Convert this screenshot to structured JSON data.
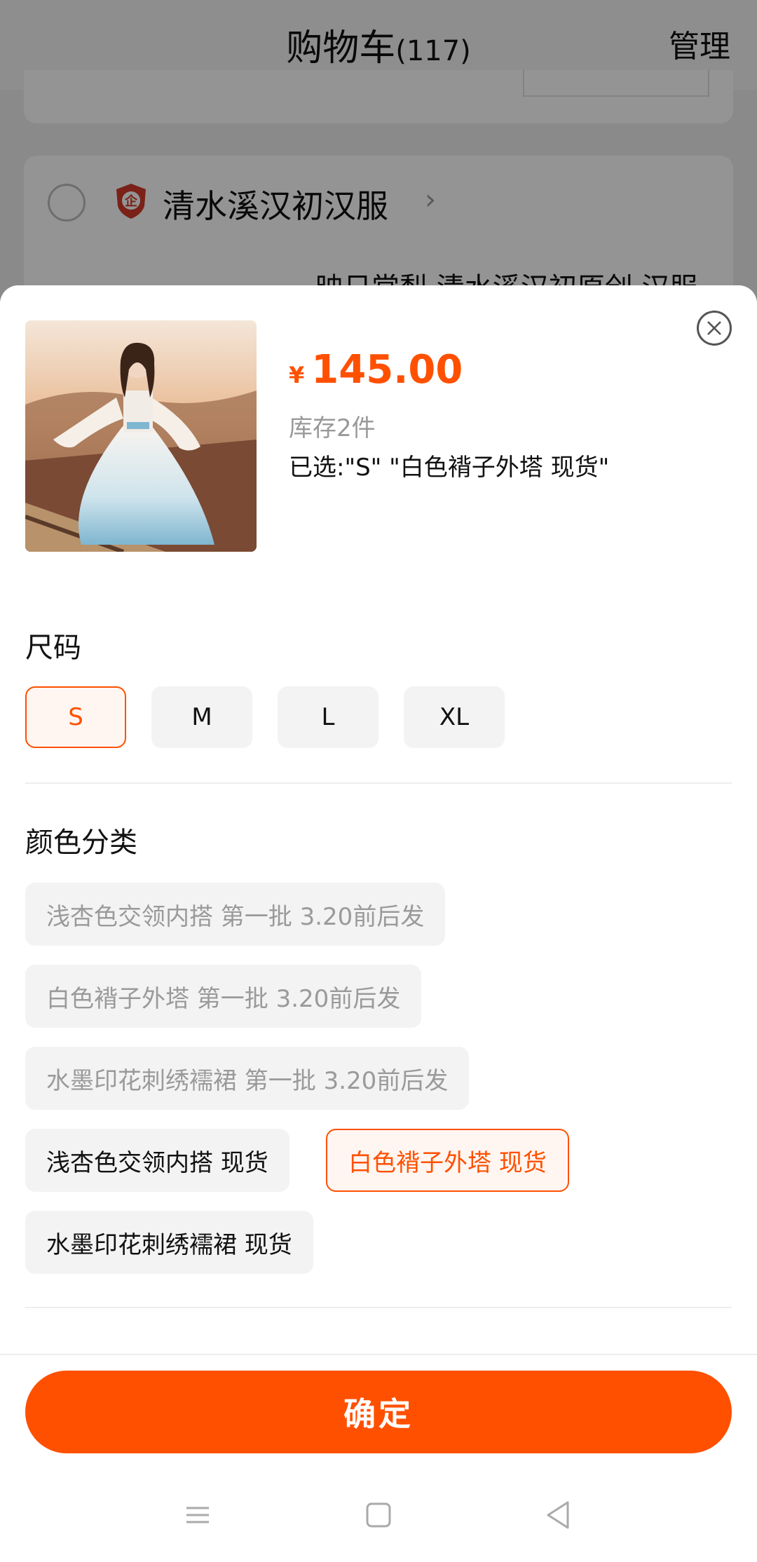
{
  "background": {
    "title": "购物车",
    "count": "(117)",
    "manage_label": "管理",
    "shop_name": "清水溪汉初汉服",
    "item_title_partial": "映日棠梨 清水溪汉初原创 汉服"
  },
  "product": {
    "currency": "¥",
    "price": "145.00",
    "stock": "库存2件",
    "selected": "已选:\"S\" \"白色褙子外塔 现货\""
  },
  "size": {
    "title": "尺码",
    "options": [
      "S",
      "M",
      "L",
      "XL"
    ],
    "selected": "S"
  },
  "color": {
    "title": "颜色分类",
    "options": [
      "浅杏色交领内搭 第一批 3.20前后发",
      "白色褙子外塔 第一批 3.20前后发",
      "水墨印花刺绣襦裙 第一批 3.20前后发",
      "浅杏色交领内搭 现货",
      "白色褙子外塔 现货",
      "水墨印花刺绣襦裙 现货"
    ],
    "selected": "白色褙子外塔 现货"
  },
  "confirm_label": "确定",
  "colors": {
    "accent": "#ff5000",
    "chip_bg": "#f3f3f3",
    "disabled_text": "#9a9a9a"
  }
}
